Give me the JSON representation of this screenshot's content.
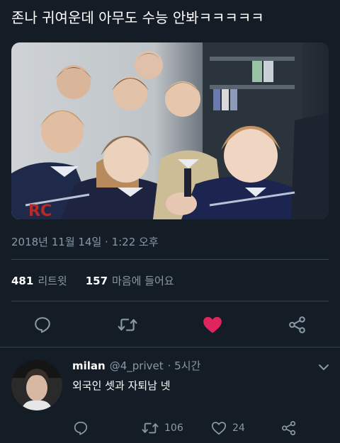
{
  "tweet": {
    "text": "존나 귀여운데 아무도 수능 안봐ㅋㅋㅋㅋㅋ",
    "timestamp": "2018년 11월 14일 · 1:22 오후",
    "retweet_count": "481",
    "retweet_label": "리트윗",
    "like_count": "157",
    "like_label": "마음에 들어요",
    "liked": true
  },
  "reply": {
    "name": "milan",
    "handle": "@4_privet",
    "time": "· 5시간",
    "text": "외국인 셋과 자퇴남 넷",
    "retweet_count": "106",
    "like_count": "24"
  },
  "colors": {
    "background": "#141d26",
    "secondary_text": "#8899a6",
    "divider": "#38444d",
    "like_accent": "#e0245e"
  },
  "icons": {
    "reply": "reply-icon",
    "retweet": "retweet-icon",
    "like": "heart-icon",
    "share": "share-icon",
    "more": "chevron-down-icon"
  }
}
